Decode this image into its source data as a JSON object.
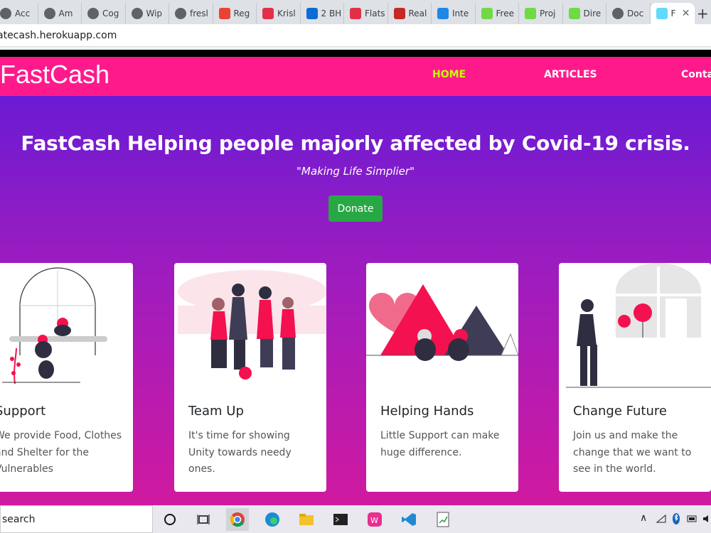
{
  "browser": {
    "tabs": [
      {
        "label": "Acc",
        "icon": "account-icon",
        "color": "#5f6368"
      },
      {
        "label": "Am",
        "icon": "globe-icon",
        "color": "#5f6368"
      },
      {
        "label": "Cog",
        "icon": "globe-icon",
        "color": "#5f6368"
      },
      {
        "label": "Wip",
        "icon": "globe-icon",
        "color": "#5f6368"
      },
      {
        "label": "fresl",
        "icon": "globe-icon",
        "color": "#5f6368"
      },
      {
        "label": "Reg",
        "icon": "gmail-icon",
        "color": "#ea4335"
      },
      {
        "label": "Krisl",
        "icon": "circle-icon",
        "color": "#e2304a"
      },
      {
        "label": "2 BH",
        "icon": "99-icon",
        "color": "#0b6cd6"
      },
      {
        "label": "Flats",
        "icon": "circle-icon",
        "color": "#e2304a"
      },
      {
        "label": "Real",
        "icon": "mb-icon",
        "color": "#c62828"
      },
      {
        "label": "Inte",
        "icon": "is-icon",
        "color": "#1e88e5"
      },
      {
        "label": "Free",
        "icon": "upwork-icon",
        "color": "#6fda44"
      },
      {
        "label": "Proj",
        "icon": "upwork-icon",
        "color": "#6fda44"
      },
      {
        "label": "Dire",
        "icon": "upwork-icon",
        "color": "#6fda44"
      },
      {
        "label": "Doc",
        "icon": "globe-icon",
        "color": "#5f6368"
      },
      {
        "label": "F",
        "icon": "react-icon",
        "color": "#61dafb",
        "active": true
      }
    ],
    "new_tab_glyph": "+",
    "close_glyph": "✕",
    "url": "atecash.herokuapp.com"
  },
  "site": {
    "brand": "FastCash",
    "nav": {
      "home": "HOME",
      "articles": "ARTICLES",
      "contact": "Conta"
    },
    "hero": {
      "headline": "FastCash Helping people majorly affected by Covid-19 crisis.",
      "tagline": "\"Making Life Simplier\"",
      "donate_label": "Donate"
    },
    "cards": [
      {
        "title": "Support",
        "text": "We provide Food, Clothes and Shelter for the Vulnerables"
      },
      {
        "title": "Team Up",
        "text": "It's time for showing Unity towards needy ones."
      },
      {
        "title": "Helping Hands",
        "text": "Little Support can make huge difference."
      },
      {
        "title": "Change Future",
        "text": "Join us and make the change that we want to see in the world."
      }
    ],
    "colors": {
      "nav_bg": "#ff1a8c",
      "nav_active": "#c6ff00",
      "accent": "#f4114f",
      "donate": "#28a745"
    }
  },
  "taskbar": {
    "search_placeholder": "search",
    "apps": [
      "cortana-icon",
      "task-view-icon",
      "chrome-icon",
      "edge-icon",
      "file-explorer-icon",
      "terminal-icon",
      "webstorm-icon",
      "vscode-icon",
      "notepad-icon"
    ]
  }
}
